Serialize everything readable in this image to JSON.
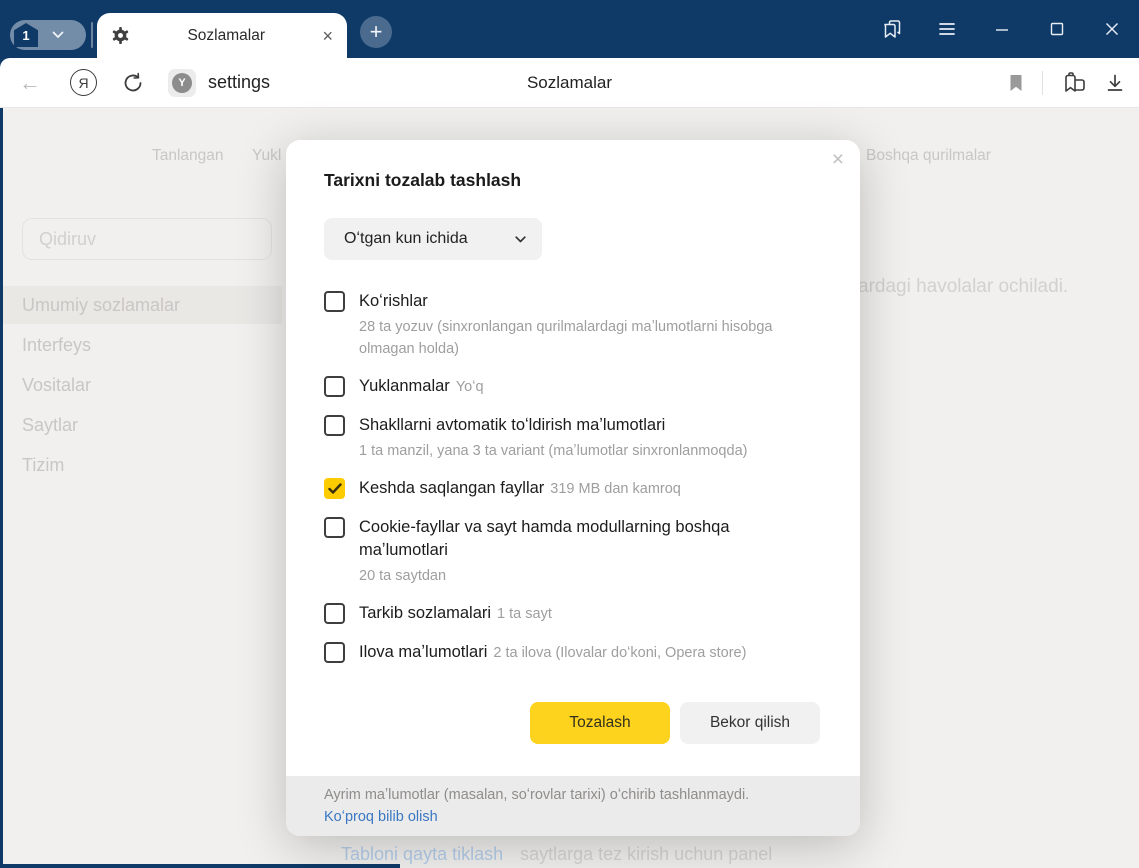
{
  "titlebar": {
    "tab_count": "1",
    "tab_title": "Sozlamalar"
  },
  "toolbar": {
    "url_text": "settings",
    "page_title": "Sozlamalar",
    "favicon_letter": "Y",
    "browser_logo_letter": "Я"
  },
  "icons": {
    "back_glyph": "←",
    "close_glyph": "×",
    "plus_glyph": "+"
  },
  "settings_page": {
    "top_nav": [
      "Tanlangan",
      "Yukl",
      "Boshqa qurilmalar"
    ],
    "search_placeholder": "Qidiruv",
    "sidebar_items": [
      "Umumiy sozlamalar",
      "Interfeys",
      "Vositalar",
      "Saytlar",
      "Tizim"
    ],
    "active_sidebar_item": "Umumiy sozlamalar",
    "background_text_right": "ardagi havolalar ochiladi.",
    "bottom_link": "Tabloni qayta tiklash",
    "bottom_text": "saytlarga tez kirish uchun panel"
  },
  "dialog": {
    "title": "Tarixni tozalab tashlash",
    "period_selected": "Oʻtgan kun ichida",
    "items": [
      {
        "label": "Koʻrishlar",
        "detail": "28 ta yozuv (sinxronlangan qurilmalardagi maʼlumotlarni hisobga olmagan holda)",
        "inline": false,
        "checked": false
      },
      {
        "label": "Yuklanmalar",
        "detail": "Yoʻq",
        "inline": true,
        "checked": false
      },
      {
        "label": "Shakllarni avtomatik toʻldirish maʼlumotlari",
        "detail": "1 ta manzil, yana 3 ta variant (maʼlumotlar sinxronlanmoqda)",
        "inline": false,
        "checked": false
      },
      {
        "label": "Keshda saqlangan fayllar",
        "detail": "319 MB dan kamroq",
        "inline": true,
        "checked": true
      },
      {
        "label": "Cookie-fayllar va sayt hamda modullarning boshqa maʼlumotlari",
        "detail": "20 ta saytdan",
        "inline": false,
        "checked": false
      },
      {
        "label": "Tarkib sozlamalari",
        "detail": "1 ta sayt",
        "inline": true,
        "checked": false
      },
      {
        "label": "Ilova maʼlumotlari",
        "detail": "2 ta ilova (Ilovalar doʻkoni, Opera store)",
        "inline": true,
        "checked": false
      }
    ],
    "confirm_label": "Tozalash",
    "cancel_label": "Bekor qilish",
    "footer_note": "Ayrim maʼlumotlar (masalan, soʻrovlar tarixi) oʻchirib tashlanmaydi.",
    "footer_link": "Koʻproq bilib olish"
  },
  "colors": {
    "frame_navy": "#0f3a68",
    "accent_yellow": "#fdd31d",
    "checkbox_yellow": "#fccc00",
    "link_blue": "#3a77c2"
  }
}
